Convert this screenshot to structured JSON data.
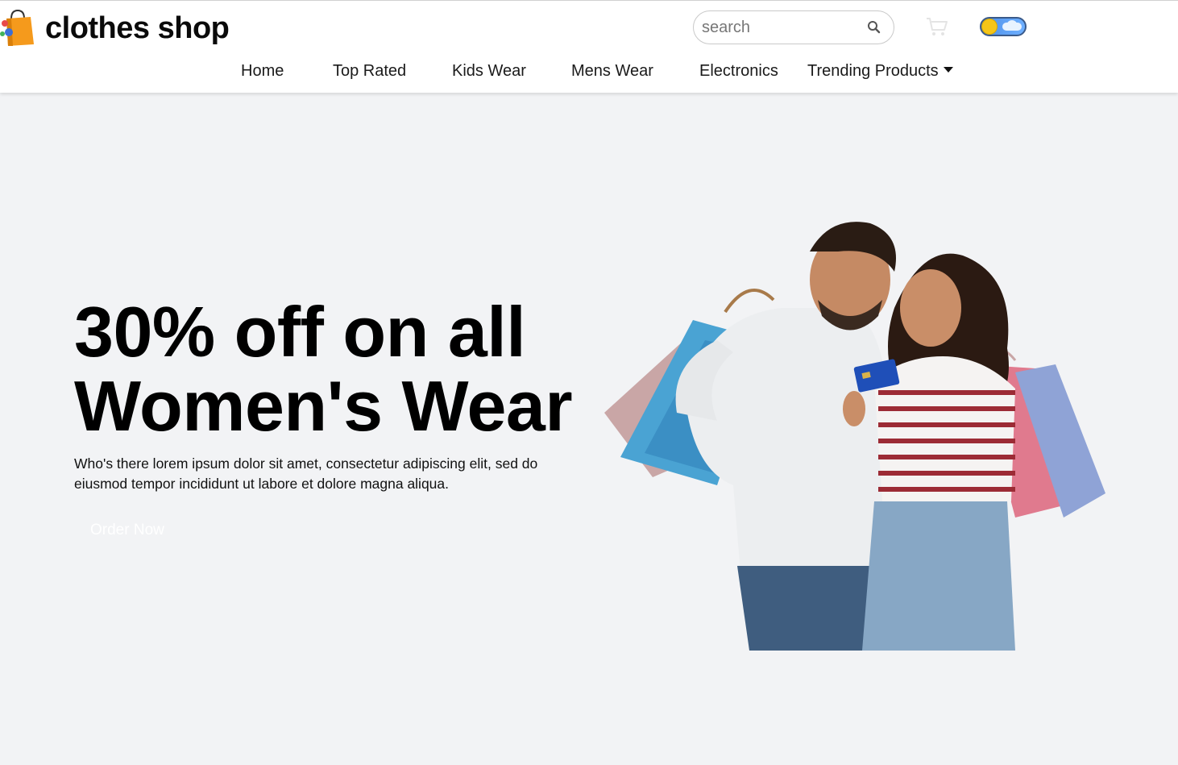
{
  "header": {
    "logo_text": "clothes shop",
    "search": {
      "placeholder": "search",
      "value": ""
    },
    "icons": {
      "logo": "shopping-bag-icon",
      "search": "search-icon",
      "cart": "cart-icon",
      "theme_toggle": "theme-toggle-sun-cloud"
    },
    "nav": {
      "items": [
        {
          "label": "Home"
        },
        {
          "label": "Top Rated"
        },
        {
          "label": "Kids Wear"
        },
        {
          "label": "Mens Wear"
        },
        {
          "label": "Electronics"
        },
        {
          "label": "Trending Products",
          "has_dropdown": true
        }
      ]
    }
  },
  "hero": {
    "title_line1": "30% off on all",
    "title_line2": "Women's Wear",
    "description": "Who's there lorem ipsum dolor sit amet, consectetur adipiscing elit, sed do eiusmod tempor incididunt ut labore et dolore magna aliqua.",
    "cta_label": "Order Now",
    "image": "couple-with-shopping-bags"
  },
  "colors": {
    "page_bg": "#f2f3f5",
    "header_bg": "#ffffff",
    "logo_bag": "#f59a1c",
    "toggle_track": "#4c8fe8",
    "toggle_knob": "#f5c518",
    "cta_text": "#ffffff"
  }
}
